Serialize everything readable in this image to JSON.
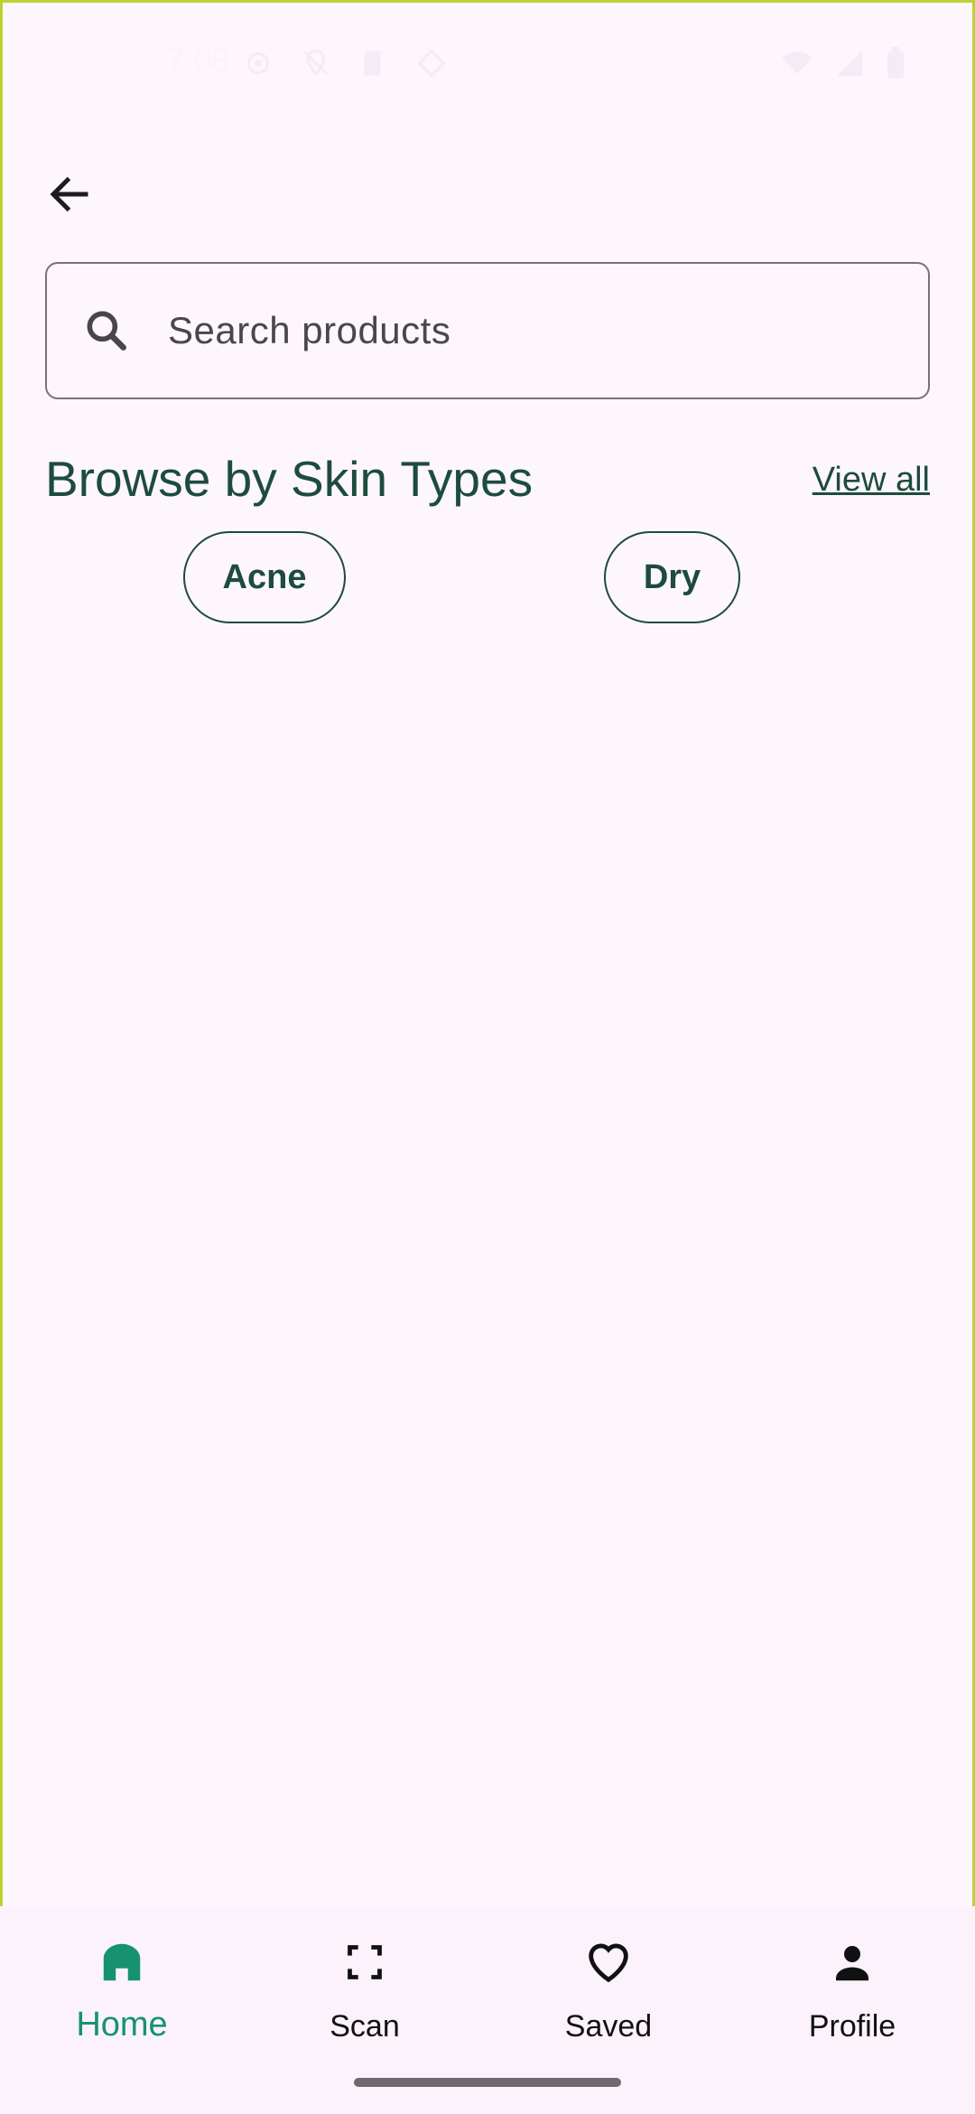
{
  "status_bar": {
    "time": "7:08"
  },
  "search": {
    "placeholder": "Search products"
  },
  "section": {
    "title": "Browse by Skin Types",
    "view_all": "View all"
  },
  "chips": [
    {
      "label": "Acne"
    },
    {
      "label": "Dry"
    }
  ],
  "bottom_nav": {
    "items": [
      {
        "label": "Home",
        "icon": "home-icon",
        "active": true
      },
      {
        "label": "Scan",
        "icon": "scan-icon",
        "active": false
      },
      {
        "label": "Saved",
        "icon": "heart-icon",
        "active": false
      },
      {
        "label": "Profile",
        "icon": "person-icon",
        "active": false
      }
    ]
  },
  "colors": {
    "background": "#fdf6fd",
    "accent": "#1d4c3c",
    "active_nav": "#169270"
  }
}
